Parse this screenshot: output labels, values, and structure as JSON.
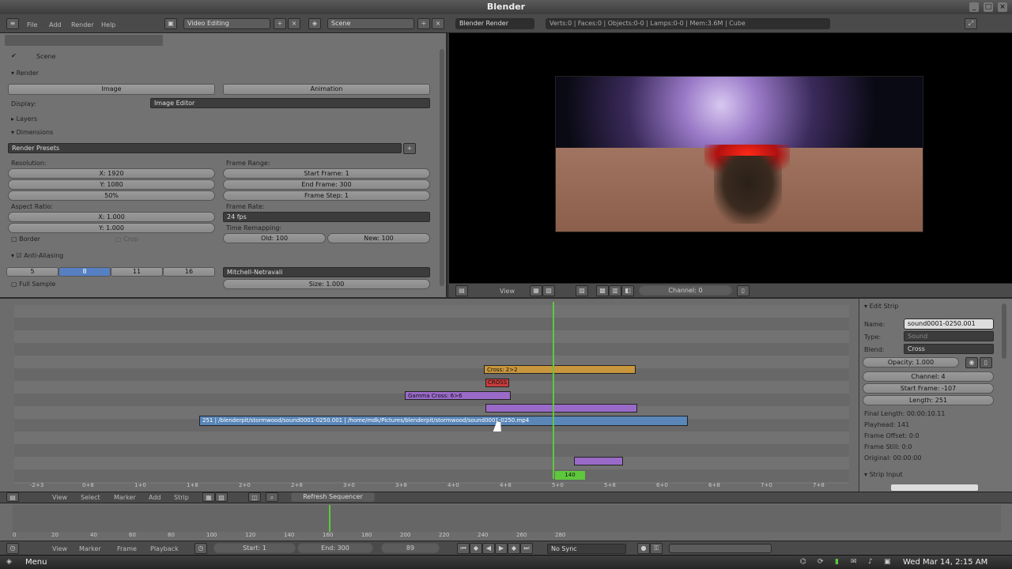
{
  "window": {
    "title": "Blender"
  },
  "topbar": {
    "menus": [
      "File",
      "Add",
      "Render",
      "Help"
    ],
    "screen": "Video Editing",
    "scene": "Scene",
    "engine": "Blender Render",
    "info": "Verts:0 | Faces:0 | Objects:0-0 | Lamps:0-0 | Mem:3.6M | Cube"
  },
  "properties": {
    "scene_label": "Scene",
    "render_panel": "Render",
    "image_button": "Image",
    "animation_button": "Animation",
    "display_label": "Display:",
    "display_value": "Image Editor",
    "layers_panel": "Layers",
    "dimensions_panel": "Dimensions",
    "presets_value": "Render Presets",
    "resolution_label": "Resolution:",
    "res_x": "X: 1920",
    "res_y": "Y: 1080",
    "res_pct": "50%",
    "frame_range_label": "Frame Range:",
    "start_frame": "Start Frame: 1",
    "end_frame": "End Frame: 300",
    "frame_step": "Frame Step: 1",
    "aspect_label": "Aspect Ratio:",
    "aspect_x": "X: 1.000",
    "aspect_y": "Y: 1.000",
    "frame_rate_label": "Frame Rate:",
    "frame_rate_value": "24 fps",
    "time_remap_label": "Time Remapping:",
    "time_old": "Old: 100",
    "time_new": "New: 100",
    "border_label": "Border",
    "crop_label": "Crop",
    "aa_label": "Anti-Aliasing",
    "aa_options": [
      "5",
      "8",
      "11",
      "16"
    ],
    "aa_selected": 1,
    "filter_value": "Mitchell-Netravali",
    "full_sample_label": "Full Sample",
    "size_value": "Size: 1.000"
  },
  "preview_header": {
    "view_menu": "View",
    "channel_value": "Channel: 0"
  },
  "sequencer": {
    "strips": [
      {
        "label": "Cross: 2>2",
        "color": "#c8963c"
      },
      {
        "label": "CROSS",
        "color": "#c83c3c"
      },
      {
        "label": "Gamma Cross: 6>6",
        "color": "#9a6ac8"
      },
      {
        "label": "",
        "color": "#9a6ac8"
      },
      {
        "label": "251 | /blenderpit/stormwood/sound0001-0250.001 | /home/mdk/Pictures/blenderpit/stormwood/sound0001-0250.mp4",
        "color": "#5a86b8"
      },
      {
        "label": "",
        "color": "#9a6ac8"
      }
    ],
    "playhead_frame": "140",
    "ticks": [
      "-2+3",
      "0+8",
      "1+0",
      "1+8",
      "2+0",
      "2+8",
      "3+0",
      "3+8",
      "4+0",
      "4+8",
      "5+0",
      "5+8",
      "6+0",
      "6+8",
      "7+0",
      "7+8"
    ]
  },
  "strip_panel": {
    "title": "Edit Strip",
    "name_label": "Name:",
    "name_value": "sound0001-0250.001",
    "type_label": "Type:",
    "type_value": "Sound",
    "blend_label": "Blend:",
    "blend_value": "Cross",
    "opacity": "Opacity: 1.000",
    "channel": "Channel: 4",
    "start": "Start Frame: -107",
    "length": "Length: 251",
    "final_length": "Final Length: 00:00:10.11",
    "playhead": "Playhead: 141",
    "frame_offset": "Frame Offset: 0:0",
    "frame_still": "Frame Still: 0:0",
    "origin": "Original: 00:00:00",
    "strip_input": "Strip Input"
  },
  "seq_header": {
    "menus": [
      "View",
      "Select",
      "Marker",
      "Add",
      "Strip"
    ],
    "refresh": "Refresh Sequencer"
  },
  "timeline": {
    "ticks": [
      "0",
      "20",
      "40",
      "60",
      "80",
      "100",
      "120",
      "140",
      "160",
      "180",
      "200",
      "220",
      "240",
      "260",
      "280"
    ]
  },
  "timeline_header": {
    "menus": [
      "View",
      "Marker",
      "Frame",
      "Playback"
    ],
    "start": "Start: 1",
    "end": "End: 300",
    "current": "89",
    "sync": "No Sync"
  },
  "taskbar": {
    "menu": "Menu",
    "clock": "Wed Mar 14,  2:15 AM"
  }
}
